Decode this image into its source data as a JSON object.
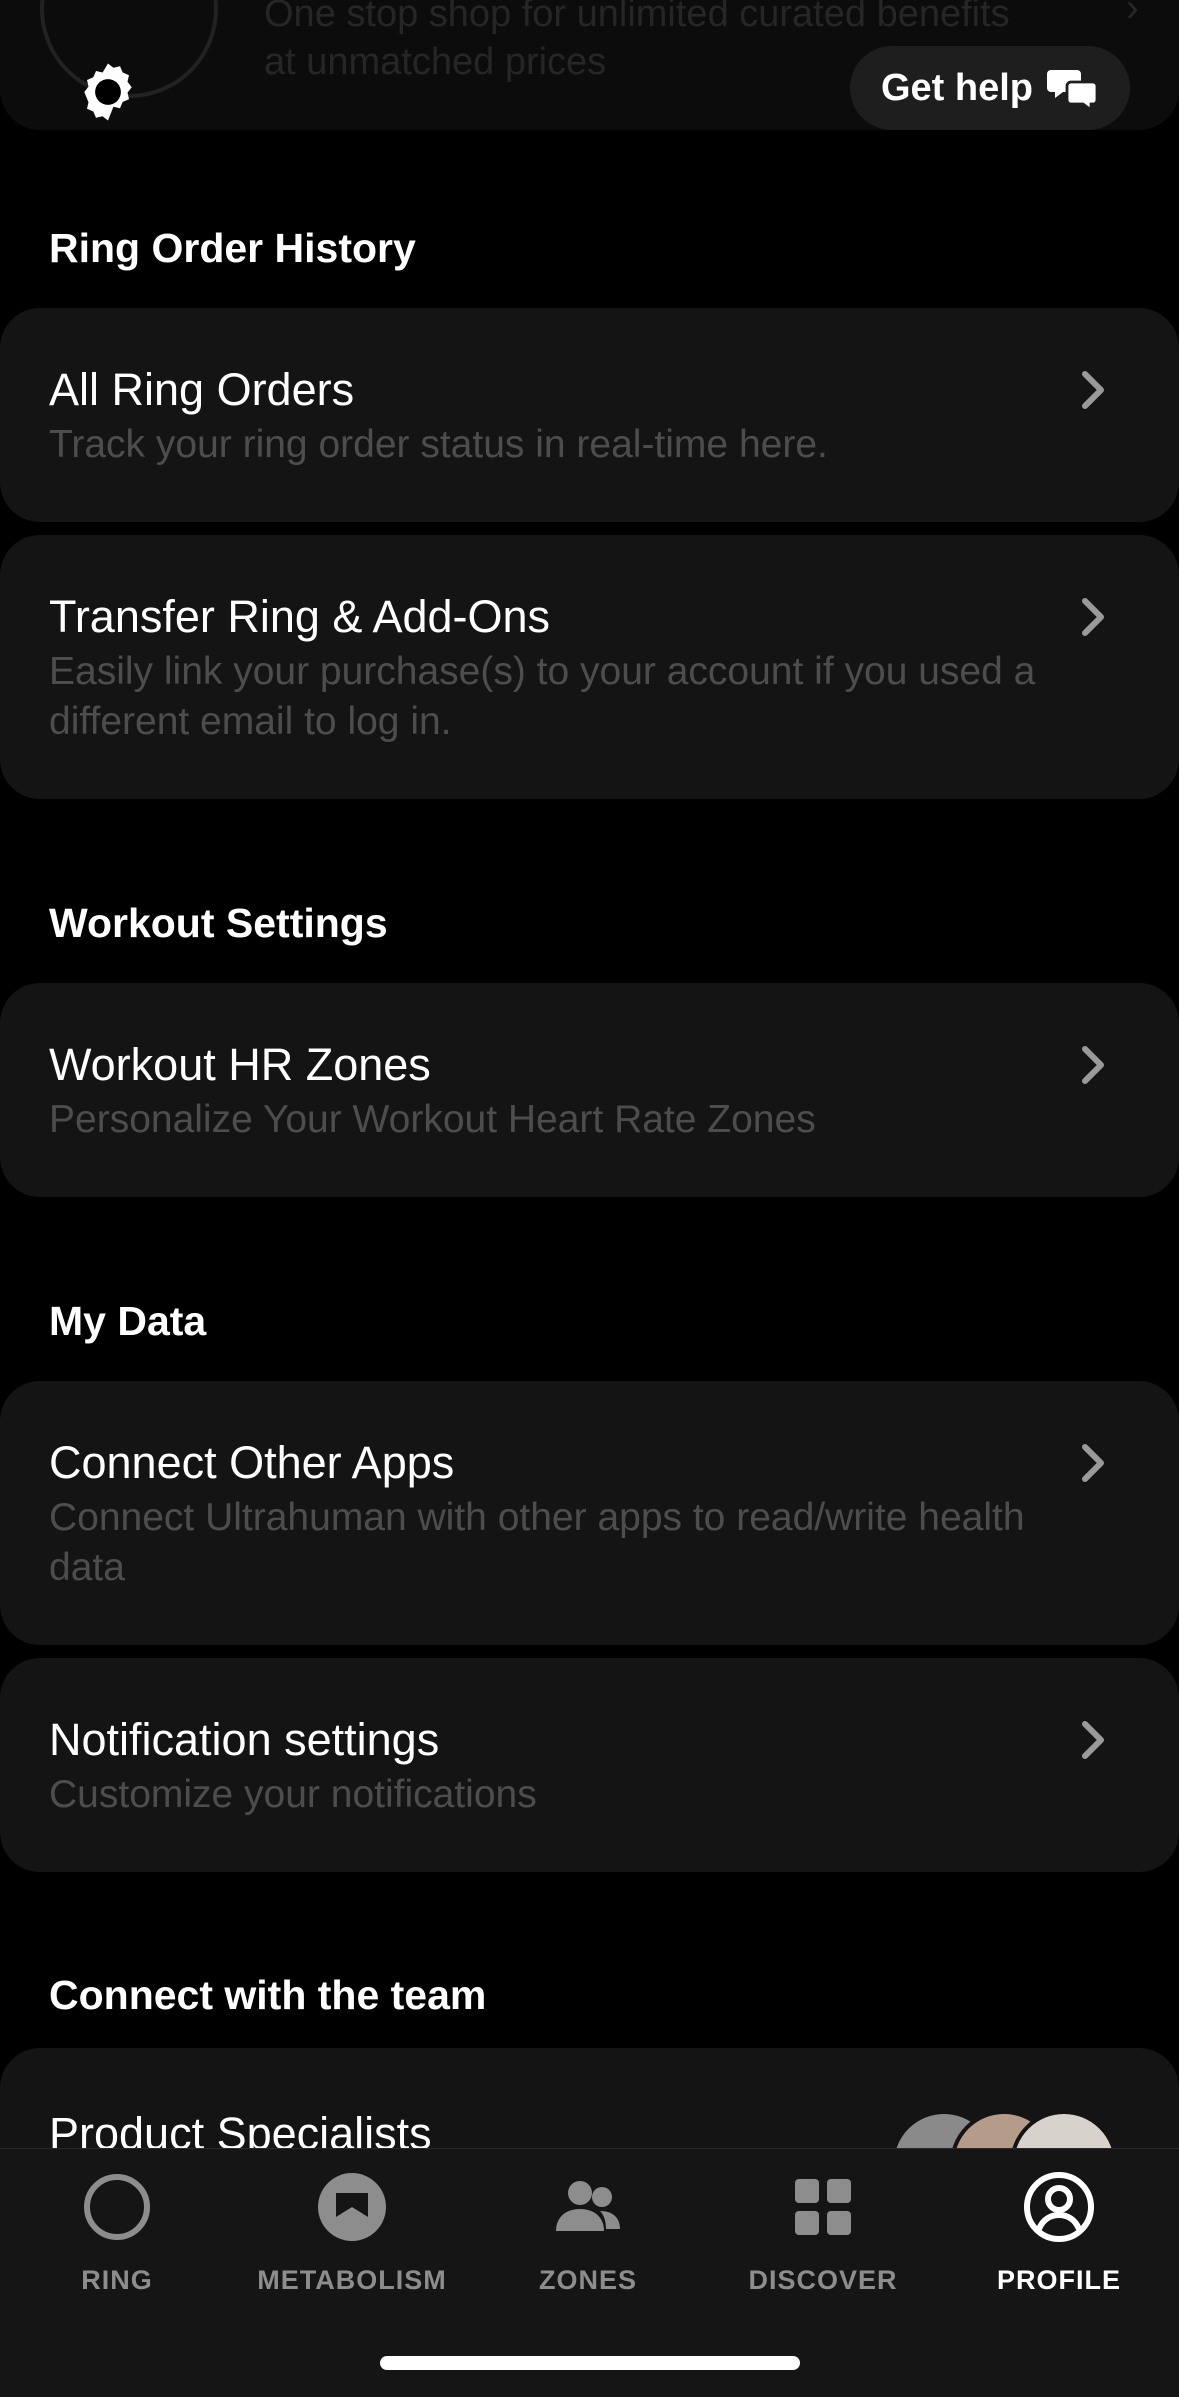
{
  "promo": {
    "text": "One stop shop for unlimited curated benefits at unmatched prices"
  },
  "header": {
    "settings_icon": "gear-icon",
    "help_label": "Get help",
    "help_icon": "chat-bubbles-icon"
  },
  "sections": {
    "ring_orders": {
      "title": "Ring Order History",
      "items": [
        {
          "title": "All Ring Orders",
          "subtitle": "Track your ring order status in real-time here."
        },
        {
          "title": "Transfer Ring & Add-Ons",
          "subtitle": "Easily link your purchase(s) to your account if you used a different email to log in."
        }
      ]
    },
    "workout": {
      "title": "Workout Settings",
      "items": [
        {
          "title": "Workout HR Zones",
          "subtitle": "Personalize Your Workout Heart Rate Zones"
        }
      ]
    },
    "my_data": {
      "title": "My Data",
      "items": [
        {
          "title": "Connect Other Apps",
          "subtitle": "Connect Ultrahuman with other apps to read/write health data"
        },
        {
          "title": "Notification settings",
          "subtitle": "Customize your notifications"
        }
      ]
    },
    "team": {
      "title": "Connect with the team",
      "items": [
        {
          "title": "Product Specialists"
        }
      ]
    }
  },
  "tabbar": {
    "tabs": [
      {
        "label": "RING",
        "icon": "ring-icon"
      },
      {
        "label": "METABOLISM",
        "icon": "metabolism-icon"
      },
      {
        "label": "ZONES",
        "icon": "zones-icon"
      },
      {
        "label": "DISCOVER",
        "icon": "grid-icon"
      },
      {
        "label": "PROFILE",
        "icon": "profile-icon",
        "active": true
      }
    ]
  },
  "colors": {
    "background": "#000000",
    "card": "#141414",
    "subtitle": "#4d4d4d",
    "tab_inactive": "#8d8d8d"
  }
}
